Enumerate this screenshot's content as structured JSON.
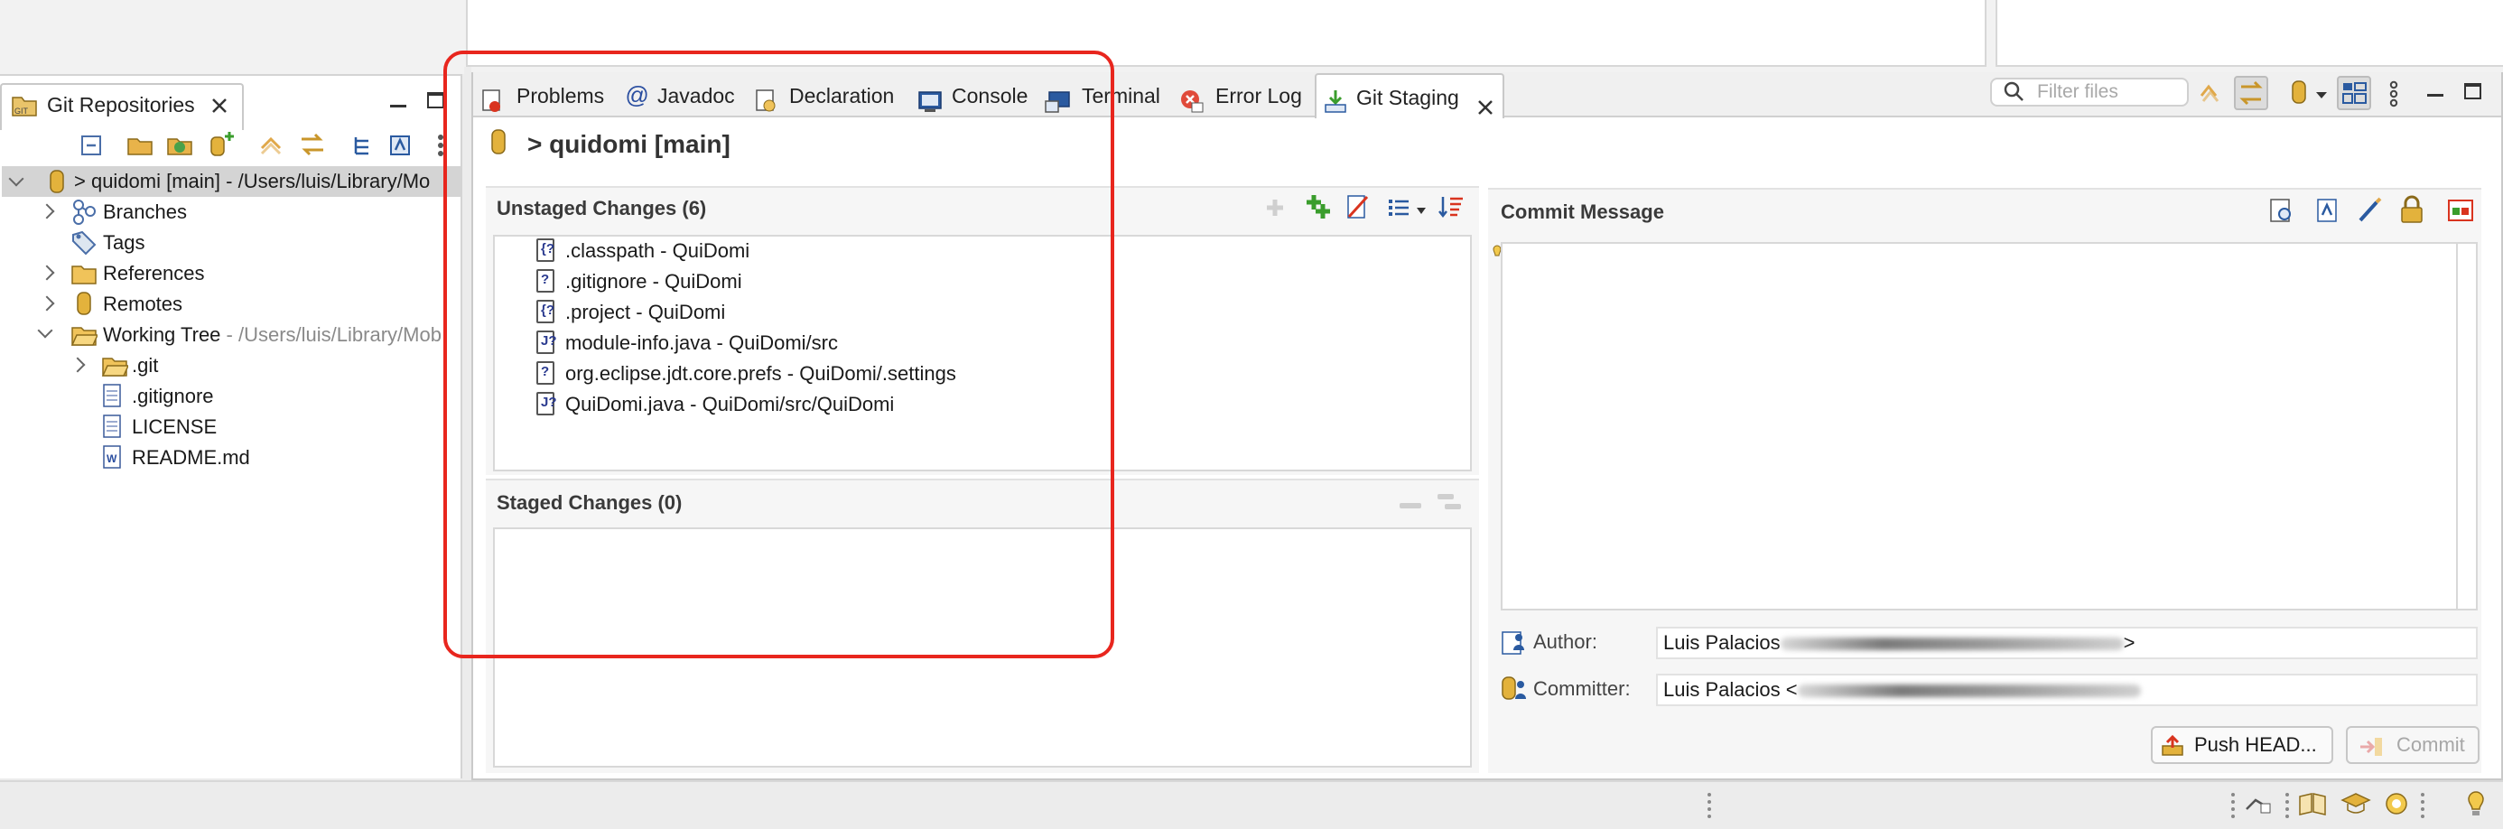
{
  "left_view": {
    "tab_title": "Git Repositories",
    "tree": {
      "repo_label": "> quidomi [main] - /Users/luis/Library/Mo",
      "branches": "Branches",
      "tags": "Tags",
      "references": "References",
      "remotes": "Remotes",
      "working_tree": "Working Tree",
      "working_tree_path": " - /Users/luis/Library/Mob",
      "git_folder": ".git",
      "gitignore": ".gitignore",
      "license": "LICENSE",
      "readme": "README.md"
    }
  },
  "right_view": {
    "tabs": [
      "Problems",
      "Javadoc",
      "Declaration",
      "Console",
      "Terminal",
      "Error Log",
      "Git Staging"
    ],
    "active_tab": "Git Staging",
    "filter_placeholder": "Filter files",
    "repo_header": "> quidomi [main]",
    "unstaged": {
      "title": "Unstaged Changes (6)",
      "files": [
        ".classpath - QuiDomi",
        ".gitignore - QuiDomi",
        ".project - QuiDomi",
        "module-info.java - QuiDomi/src",
        "org.eclipse.jdt.core.prefs - QuiDomi/.settings",
        "QuiDomi.java - QuiDomi/src/QuiDomi"
      ]
    },
    "staged": {
      "title": "Staged Changes (0)"
    },
    "commit": {
      "title": "Commit Message",
      "message": "",
      "author_label": "Author:",
      "author_value": "Luis Palacios",
      "author_suffix": ">",
      "committer_label": "Committer:",
      "committer_value": "Luis Palacios <",
      "push_button": "Push HEAD...",
      "commit_button": "Commit"
    }
  },
  "colors": {
    "annotation": "#e8261e",
    "accent_green": "#3a9d2c",
    "folder": "#e6b54a"
  }
}
